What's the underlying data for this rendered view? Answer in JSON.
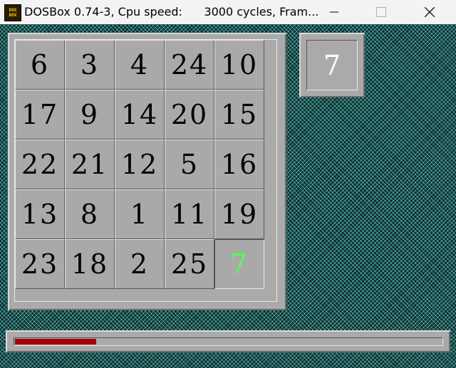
{
  "window": {
    "title": "DOSBox 0.74-3, Cpu speed:      3000 cycles, Fram...",
    "icon_name": "dosbox-icon",
    "icon_text": [
      "DOS",
      "BOX"
    ]
  },
  "controls": {
    "minimize_icon": "minimize-icon",
    "maximize_icon": "maximize-icon",
    "close_icon": "close-icon"
  },
  "board": {
    "rows": [
      [
        "6",
        "3",
        "4",
        "24",
        "10"
      ],
      [
        "17",
        "9",
        "14",
        "20",
        "15"
      ],
      [
        "22",
        "21",
        "12",
        "5",
        "16"
      ],
      [
        "13",
        "8",
        "1",
        "11",
        "19"
      ],
      [
        "23",
        "18",
        "2",
        "25",
        "7"
      ]
    ],
    "active_cell": {
      "row": 4,
      "col": 4
    },
    "active_color": "#55ff55",
    "tile_color": "#a9a9a9"
  },
  "next_tile": {
    "value": "7",
    "color": "#ffffff"
  },
  "progress": {
    "fraction": 0.19,
    "color": "#a80000"
  }
}
